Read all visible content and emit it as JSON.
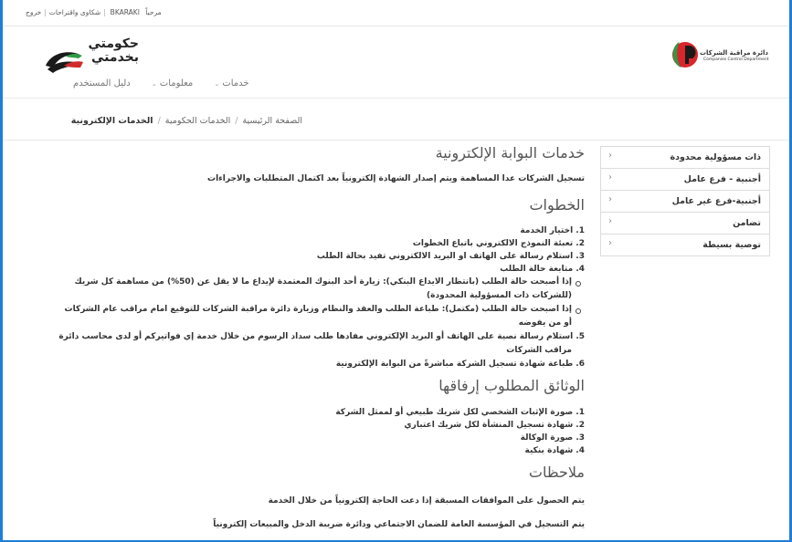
{
  "topbar": {
    "greeting": "مرحباً",
    "username": "BKARAKI",
    "complaints_link": "شكاوى واقتراحات",
    "logout_link": "خروج"
  },
  "brand": {
    "name_line1": "حكومتي",
    "name_line2": "بخدمتي"
  },
  "nav": {
    "services": "خدمات",
    "information": "معلومات",
    "user_guide": "دليل المستخدم"
  },
  "ccd": {
    "name": "دائرة مراقبة الشركات",
    "name_en": "Companies Control Department"
  },
  "breadcrumb": {
    "home": "الصفحة الرئيسية",
    "gov_services": "الخدمات الحكومية",
    "current": "الخدمات الإلكترونية"
  },
  "sidebar": {
    "items": [
      {
        "label": "ذات مسؤولية محدودة"
      },
      {
        "label": "أجنبية - فرع عامل"
      },
      {
        "label": "أجنبية-فرع غير عامل"
      },
      {
        "label": "تضامن"
      },
      {
        "label": "توصية بسيطة"
      }
    ]
  },
  "main": {
    "title": "خدمات البوابة الإلكترونية",
    "intro": "تسجيل الشركات عدا المساهمة ويتم إصدار الشهادة إلكترونياً بعد اكتمال المتطلبات والاجراءات",
    "steps_title": "الخطوات",
    "steps": [
      "1. اختيار الخدمة",
      "2. تعبئة النموذج الالكتروني باتباع الخطوات",
      "3. استلام رسالة على الهاتف او البريد الالكتروني تفيد بحالة الطلب",
      "4. متابعة حالة الطلب"
    ],
    "sub_bullets": [
      "إذا أصبحت حالة الطلب (بانتظار الايداع البنكي): زيارة أحد البنوك المعتمدة لإيداع ما لا يقل عن (50%) من مساهمة كل شريك",
      "(للشركات ذات المسؤولية المحدودة)",
      "إذا اصبحت حالة الطلب (مكتمل): طباعة الطلب والعقد والنظام وزيارة دائرة مراقبة الشركات للتوقيع امام مراقب عام الشركات",
      "أو من يفوضه"
    ],
    "steps_after": [
      "5. استلام رسالة نصية على الهاتف أو البريد الإلكتروني مفادها طلب سداد الرسوم من خلال خدمة إي فواتيركم أو لدى محاسب دائرة",
      "مراقب الشركات",
      "6. طباعة شهادة تسجيل الشركة مباشرةً من البوابة الإلكترونية"
    ],
    "docs_title": "الوثائق المطلوب إرفاقها",
    "docs": [
      "1. صورة الإثبات الشخصي لكل شريك طبيعي أو لممثل الشركة",
      "2. شهادة تسجيل المنشأة لكل شريك اعتباري",
      "3. صورة الوكالة",
      "4. شهادة بنكية"
    ],
    "notes_title": "ملاحظات",
    "notes": [
      "يتم الحصول على الموافقات المسبقة إذا دعت الحاجة إلكترونياً من خلال الخدمة",
      "يتم التسجيل في المؤسسة العامة للضمان الاجتماعي ودائرة ضريبة الدخل والمبيعات إلكترونياً"
    ]
  },
  "colors": {
    "frame_border": "#1d7fd8",
    "ccd_red": "#d8262c",
    "ccd_green": "#2f9a47"
  }
}
